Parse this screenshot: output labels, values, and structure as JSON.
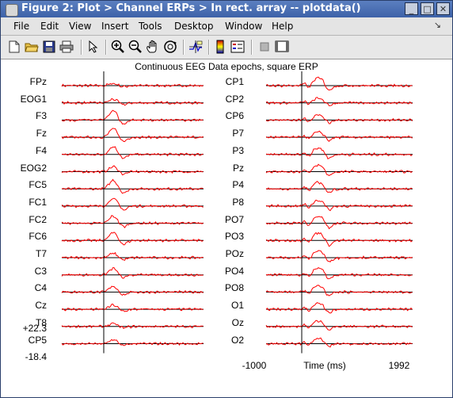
{
  "window": {
    "title": "Figure 2: Plot > Channel ERPs > In rect. array -- plotdata()",
    "buttons": {
      "minimize": "_",
      "maximize": "□",
      "close": "✕"
    }
  },
  "menu": [
    "File",
    "Edit",
    "View",
    "Insert",
    "Tools",
    "Desktop",
    "Window",
    "Help"
  ],
  "toolbar_icons": [
    "new-file-icon",
    "open-folder-icon",
    "save-icon",
    "print-icon",
    "pointer-icon",
    "zoom-in-icon",
    "zoom-out-icon",
    "pan-hand-icon",
    "rotate-3d-icon",
    "data-cursor-icon",
    "colorbar-icon",
    "legend-icon",
    "hide-plot-tools-icon",
    "show-plot-tools-icon"
  ],
  "plot": {
    "title": "Continuous EEG Data epochs, square ERP",
    "left_channels": [
      "FPz",
      "EOG1",
      "F3",
      "Fz",
      "F4",
      "EOG2",
      "FC5",
      "FC1",
      "FC2",
      "FC6",
      "T7",
      "C3",
      "C4",
      "Cz",
      "T8",
      "CP5"
    ],
    "right_channels": [
      "CP1",
      "CP2",
      "CP6",
      "P7",
      "P3",
      "Pz",
      "P4",
      "P8",
      "PO7",
      "PO3",
      "POz",
      "PO4",
      "PO8",
      "O1",
      "Oz",
      "O2"
    ],
    "scale_top": "+22.3",
    "scale_bottom": "-18.4",
    "x_min": "-1000",
    "x_label": "Time (ms)",
    "x_max": "1992",
    "trace_color": "#ff0000",
    "axis_color": "#000000"
  },
  "chart_data": {
    "type": "line",
    "title": "Continuous EEG Data epochs, square ERP",
    "xlabel": "Time (ms)",
    "xlim": [
      -1000,
      1992
    ],
    "y_scale_labels": [
      "+22.3",
      "-18.4"
    ],
    "series": [
      {
        "name": "FPz",
        "peak_ms": 200,
        "peak_uV": 3
      },
      {
        "name": "EOG1",
        "peak_ms": 200,
        "peak_uV": 5
      },
      {
        "name": "F3",
        "peak_ms": 200,
        "peak_uV": 13
      },
      {
        "name": "Fz",
        "peak_ms": 200,
        "peak_uV": 12
      },
      {
        "name": "F4",
        "peak_ms": 200,
        "peak_uV": 11
      },
      {
        "name": "EOG2",
        "peak_ms": 200,
        "peak_uV": 7
      },
      {
        "name": "FC5",
        "peak_ms": 200,
        "peak_uV": 12
      },
      {
        "name": "FC1",
        "peak_ms": 200,
        "peak_uV": 11
      },
      {
        "name": "FC2",
        "peak_ms": 200,
        "peak_uV": 10
      },
      {
        "name": "FC6",
        "peak_ms": 200,
        "peak_uV": 11
      },
      {
        "name": "T7",
        "peak_ms": 200,
        "peak_uV": 6
      },
      {
        "name": "C3",
        "peak_ms": 200,
        "peak_uV": 9
      },
      {
        "name": "C4",
        "peak_ms": 200,
        "peak_uV": 8
      },
      {
        "name": "Cz",
        "peak_ms": 200,
        "peak_uV": 6
      },
      {
        "name": "T8",
        "peak_ms": 200,
        "peak_uV": 4
      },
      {
        "name": "CP5",
        "peak_ms": 200,
        "peak_uV": 5
      },
      {
        "name": "CP1",
        "peak_ms": 350,
        "peak_uV": 12
      },
      {
        "name": "CP2",
        "peak_ms": 350,
        "peak_uV": 7
      },
      {
        "name": "CP6",
        "peak_ms": 350,
        "peak_uV": 8
      },
      {
        "name": "P7",
        "peak_ms": 350,
        "peak_uV": 8
      },
      {
        "name": "P3",
        "peak_ms": 350,
        "peak_uV": 10
      },
      {
        "name": "Pz",
        "peak_ms": 350,
        "peak_uV": 10
      },
      {
        "name": "P4",
        "peak_ms": 350,
        "peak_uV": 10
      },
      {
        "name": "P8",
        "peak_ms": 350,
        "peak_uV": 9
      },
      {
        "name": "PO7",
        "peak_ms": 350,
        "peak_uV": 11
      },
      {
        "name": "PO3",
        "peak_ms": 350,
        "peak_uV": 12
      },
      {
        "name": "POz",
        "peak_ms": 350,
        "peak_uV": 11
      },
      {
        "name": "PO4",
        "peak_ms": 350,
        "peak_uV": 11
      },
      {
        "name": "PO8",
        "peak_ms": 350,
        "peak_uV": 10
      },
      {
        "name": "O1",
        "peak_ms": 350,
        "peak_uV": 9
      },
      {
        "name": "Oz",
        "peak_ms": 350,
        "peak_uV": 9
      },
      {
        "name": "O2",
        "peak_ms": 350,
        "peak_uV": 8
      }
    ]
  }
}
